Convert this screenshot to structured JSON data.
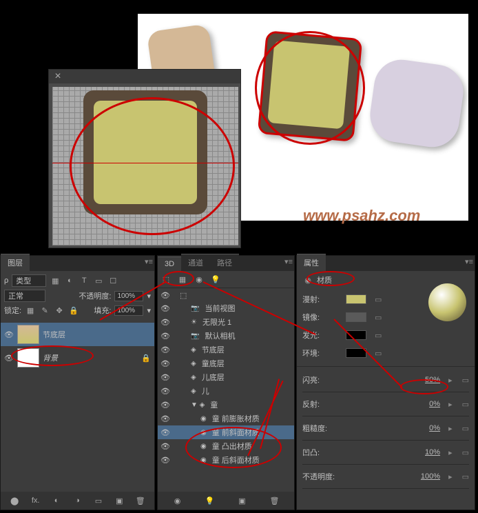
{
  "watermark": "www.psahz.com",
  "layers_panel": {
    "tab": "图层",
    "type_label": "类型",
    "blend_mode": "正常",
    "opacity_label": "不透明度:",
    "opacity_value": "100%",
    "lock_label": "锁定:",
    "fill_label": "填充:",
    "fill_value": "100%",
    "layers": [
      {
        "name": "节底层",
        "selected": true
      },
      {
        "name": "背景",
        "selected": false
      }
    ]
  },
  "panel_3d": {
    "tabs": [
      "3D",
      "通道",
      "路径"
    ],
    "items": [
      {
        "label": "当前视图",
        "indent": 1,
        "icon": "camera",
        "selected": false
      },
      {
        "label": "无限光 1",
        "indent": 1,
        "icon": "light",
        "selected": false
      },
      {
        "label": "默认相机",
        "indent": 1,
        "icon": "camera",
        "selected": false
      },
      {
        "label": "节底层",
        "indent": 1,
        "icon": "folder",
        "selected": false
      },
      {
        "label": "童底层",
        "indent": 1,
        "icon": "folder",
        "selected": false
      },
      {
        "label": "儿底层",
        "indent": 1,
        "icon": "folder",
        "selected": false
      },
      {
        "label": "儿",
        "indent": 1,
        "icon": "folder",
        "selected": false
      },
      {
        "label": "童",
        "indent": 1,
        "icon": "folder-open",
        "selected": false
      },
      {
        "label": "童 前膨胀材质",
        "indent": 2,
        "icon": "material",
        "selected": false
      },
      {
        "label": "童 前斜面材质",
        "indent": 2,
        "icon": "material",
        "selected": true
      },
      {
        "label": "童 凸出材质",
        "indent": 2,
        "icon": "material",
        "selected": false
      },
      {
        "label": "童 后斜面材质",
        "indent": 2,
        "icon": "material",
        "selected": false
      }
    ]
  },
  "props_panel": {
    "tab": "属性",
    "title": "材质",
    "rows_color": [
      {
        "label": "漫射:",
        "color": "#c8c470"
      },
      {
        "label": "镜像:",
        "color": "#5a5a5a"
      },
      {
        "label": "发光:",
        "color": "#000000"
      },
      {
        "label": "环境:",
        "color": "#000000"
      }
    ],
    "rows_slider": [
      {
        "label": "闪亮:",
        "value": "50%"
      },
      {
        "label": "反射:",
        "value": "0%"
      },
      {
        "label": "粗糙度:",
        "value": "0%"
      },
      {
        "label": "凹凸:",
        "value": "10%"
      },
      {
        "label": "不透明度:",
        "value": "100%"
      }
    ]
  }
}
